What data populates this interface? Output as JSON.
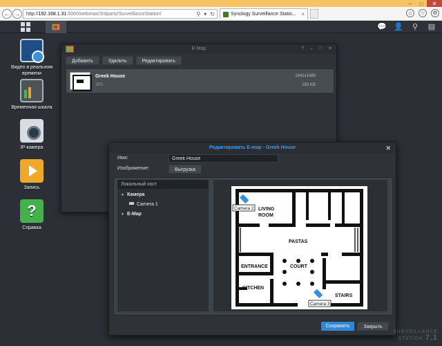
{
  "browser": {
    "address_host": "192.168.1.31",
    "address_prefix": "http://",
    "address_path": ":5000/webman/3rdparty/SurveillanceStation/",
    "tab_title": "Synology Surveillance Statio..."
  },
  "desktop": {
    "icons": [
      {
        "label": "Видео в реальном времени",
        "icon": "live-view-icon"
      },
      {
        "label": "Временная шкала",
        "icon": "timeline-icon"
      },
      {
        "label": "IP-камера",
        "icon": "ip-camera-icon"
      },
      {
        "label": "Запись",
        "icon": "recording-icon"
      },
      {
        "label": "Справка",
        "icon": "help-icon"
      }
    ]
  },
  "emap_window": {
    "title": "E-Map",
    "toolbar": {
      "add": "Добавить",
      "delete": "Удалить",
      "edit": "Редактировать"
    },
    "item": {
      "name": "Greek House",
      "type": "JPG",
      "dimensions": "1641x1485",
      "size": "193 KB"
    }
  },
  "edit_dialog": {
    "title": "Редактировать E-map - Greek House",
    "name_label": "Имя:",
    "name_value": "Greek House",
    "image_label": "Изображение:",
    "upload_label": "Выгрузка",
    "tree": {
      "header": "Локальный хост",
      "camera_group": "Камера",
      "camera_1": "Camera 1",
      "emap_group": "E-Map"
    },
    "map": {
      "rooms": [
        "LIVING ROOM",
        "PASTAS",
        "ENTRANCE",
        "COURT",
        "KITCHEN",
        "STAIRS"
      ],
      "living_room_line1": "LIVING",
      "living_room_line2": "ROOM",
      "camera_2": "Camera 2",
      "camera_3": "Camera 3"
    },
    "save": "Сохранить",
    "cancel": "Закрыть"
  },
  "watermark": {
    "line1": "SURVEILLANCE",
    "line2": "STATION",
    "version": "7.1"
  },
  "colors": {
    "titlebar": "#f7c463",
    "accent": "#2f87d8",
    "dialog_title": "#3d9be9",
    "desktop": "#2c3036"
  }
}
